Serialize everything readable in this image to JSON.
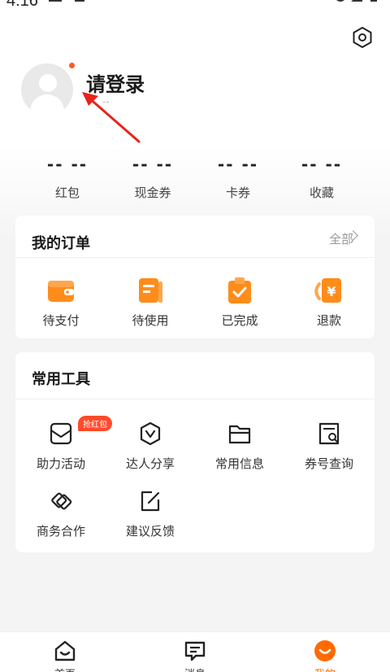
{
  "status_bar": {
    "time": "4:16"
  },
  "profile": {
    "login_prompt": "请登录",
    "subtitle": "--"
  },
  "stats": [
    {
      "value": "-- --",
      "label": "红包"
    },
    {
      "value": "-- --",
      "label": "现金券"
    },
    {
      "value": "-- --",
      "label": "卡券"
    },
    {
      "value": "-- --",
      "label": "收藏"
    }
  ],
  "orders": {
    "title": "我的订单",
    "all_label": "全部",
    "items": [
      {
        "label": "待支付",
        "icon": "wallet-icon"
      },
      {
        "label": "待使用",
        "icon": "ticket-icon"
      },
      {
        "label": "已完成",
        "icon": "clipboard-check-icon"
      },
      {
        "label": "退款",
        "icon": "refund-icon"
      }
    ]
  },
  "tools": {
    "title": "常用工具",
    "badge": "抢红包",
    "items": [
      {
        "label": "助力活动",
        "icon": "envelope-icon"
      },
      {
        "label": "达人分享",
        "icon": "shield-v-icon"
      },
      {
        "label": "常用信息",
        "icon": "folder-icon"
      },
      {
        "label": "券号查询",
        "icon": "receipt-search-icon"
      },
      {
        "label": "商务合作",
        "icon": "handshake-icon"
      },
      {
        "label": "建议反馈",
        "icon": "edit-icon"
      }
    ]
  },
  "bottom_nav": [
    {
      "label": "首页",
      "icon": "home-icon"
    },
    {
      "label": "消息",
      "icon": "message-icon"
    },
    {
      "label": "我的",
      "icon": "profile-smile-icon",
      "active": true
    }
  ],
  "colors": {
    "accent": "#ff6a00",
    "icon_orange": "#ff8c1a",
    "badge_red": "#ff4a2a"
  }
}
